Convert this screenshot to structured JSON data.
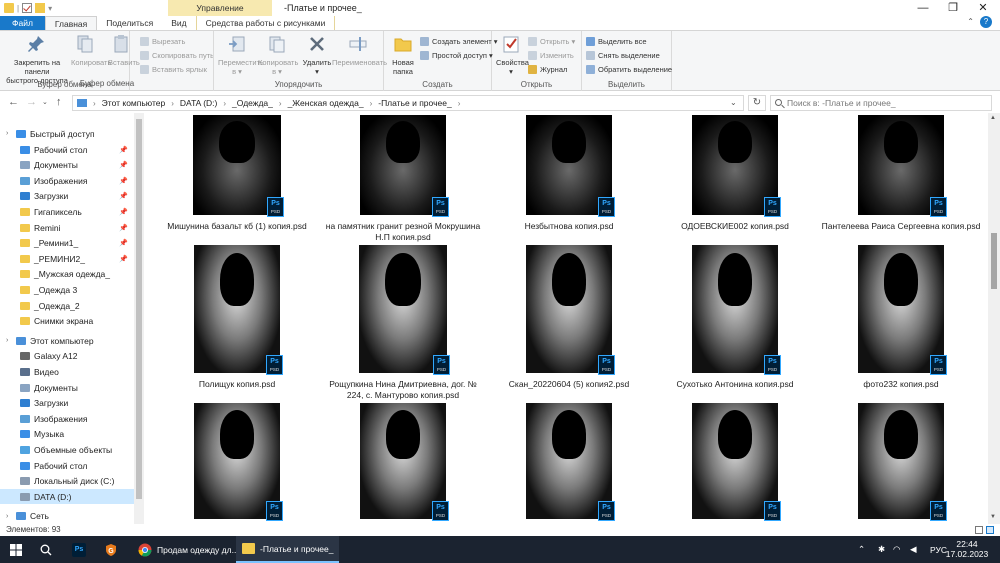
{
  "titlebar": {
    "title": "-Платье и прочее_",
    "manage_tab": "Управление",
    "minimize": "—",
    "maximize": "❐",
    "close": "✕"
  },
  "tabs": {
    "file": "Файл",
    "home": "Главная",
    "share": "Поделиться",
    "view": "Вид",
    "picture_tools": "Средства работы с рисунками"
  },
  "ribbon": {
    "clipboard": {
      "label": "Буфер обмена",
      "pin_line1": "Закрепить на панели",
      "pin_line2": "быстрого доступа",
      "copy": "Копировать",
      "paste": "Вставить",
      "cut": "Вырезать",
      "copy_path": "Скопировать путь",
      "paste_shortcut": "Вставить ярлык"
    },
    "organize": {
      "label": "Упорядочить",
      "move_line1": "Переместить",
      "move_line2": "в ▾",
      "copy_line1": "Копировать",
      "copy_line2": "в ▾",
      "delete": "Удалить",
      "delete_arrow": "▾",
      "rename": "Переименовать"
    },
    "new": {
      "label": "Создать",
      "new_folder_line1": "Новая",
      "new_folder_line2": "папка",
      "new_item": "Создать элемент ▾",
      "easy_access": "Простой доступ ▾"
    },
    "open": {
      "label": "Открыть",
      "properties": "Свойства",
      "properties_arrow": "▾",
      "open": "Открыть ▾",
      "edit": "Изменить",
      "history": "Журнал"
    },
    "select": {
      "label": "Выделить",
      "select_all": "Выделить все",
      "select_none": "Снять выделение",
      "invert": "Обратить выделение"
    }
  },
  "address": {
    "crumbs": [
      "Этот компьютер",
      "DATA (D:)",
      "_Одежда_",
      "_Женская одежда_",
      "-Платье и прочее_"
    ],
    "search_placeholder": "Поиск в: -Платье и прочее_"
  },
  "nav": {
    "quick_access": "Быстрый доступ",
    "quick_items": [
      {
        "label": "Рабочий стол",
        "color": "#3a8ee6"
      },
      {
        "label": "Документы",
        "color": "#8aa4c2"
      },
      {
        "label": "Изображения",
        "color": "#5a9fd6"
      },
      {
        "label": "Загрузки",
        "color": "#2f7fd1"
      },
      {
        "label": "Гигапиксель",
        "color": "#f2c94c"
      },
      {
        "label": "Remini",
        "color": "#f2c94c"
      },
      {
        "label": "_Ремини1_",
        "color": "#f2c94c"
      },
      {
        "label": "_РЕМИНИ2_",
        "color": "#f2c94c"
      },
      {
        "label": "_Мужская одежда_",
        "color": "#f2c94c"
      },
      {
        "label": "_Одежда 3",
        "color": "#f2c94c"
      },
      {
        "label": "_Одежда_2",
        "color": "#f2c94c"
      },
      {
        "label": "Снимки экрана",
        "color": "#f2c94c"
      }
    ],
    "this_pc": "Этот компьютер",
    "pc_items": [
      {
        "label": "Galaxy A12",
        "color": "#666666"
      },
      {
        "label": "Видео",
        "color": "#5a6f8c"
      },
      {
        "label": "Документы",
        "color": "#8aa4c2"
      },
      {
        "label": "Загрузки",
        "color": "#2f7fd1"
      },
      {
        "label": "Изображения",
        "color": "#5a9fd6"
      },
      {
        "label": "Музыка",
        "color": "#3a8ee6"
      },
      {
        "label": "Объемные объекты",
        "color": "#4fa3e0"
      },
      {
        "label": "Рабочий стол",
        "color": "#3a8ee6"
      },
      {
        "label": "Локальный диск (C:)",
        "color": "#8a9bb0"
      },
      {
        "label": "DATA (D:)",
        "color": "#8a9bb0"
      }
    ],
    "network": "Сеть"
  },
  "files": [
    {
      "name": "Мишунина базальт кб (1) копия.psd"
    },
    {
      "name": "на памятник гранит резной Мокрушина Н.П копия.psd"
    },
    {
      "name": "Незбытнова копия.psd"
    },
    {
      "name": "ОДОЕВСКИЕ002 копия.psd"
    },
    {
      "name": "Пантелеева Раиса Сергеевна копия.psd"
    },
    {
      "name": "Полищук копия.psd"
    },
    {
      "name": "Рощупкина Нина Дмитриевна, дог. № 224, с. Мантурово копия.psd"
    },
    {
      "name": "Скан_20220604 (5) копия2.psd"
    },
    {
      "name": "Сухотько Антонина копия.psd"
    },
    {
      "name": "фото232 копия.psd"
    },
    {
      "name": ""
    },
    {
      "name": ""
    },
    {
      "name": ""
    },
    {
      "name": ""
    },
    {
      "name": ""
    }
  ],
  "psd_badge": {
    "ps": "Ps",
    "ext": "PSD"
  },
  "status": {
    "count": "Элементов: 93"
  },
  "taskbar": {
    "chrome_title": "Продам одежду дл...",
    "explorer_title": "-Платье и прочее_",
    "lang": "РУС",
    "time": "22:44",
    "date": "17.02.2023",
    "ps_label": "Ps"
  }
}
